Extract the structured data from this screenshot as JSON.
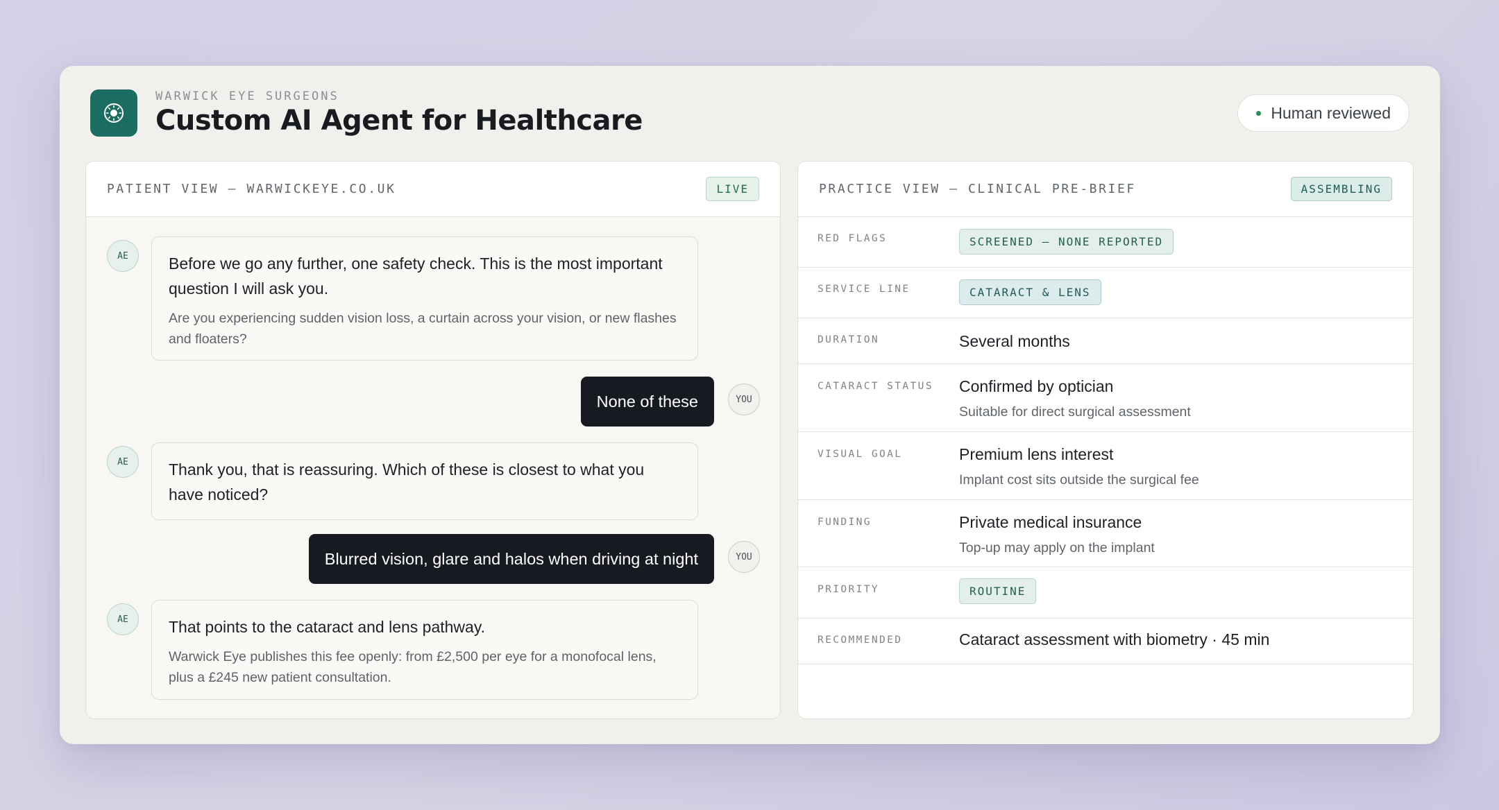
{
  "header": {
    "eyebrow": "WARWICK EYE SURGEONS",
    "title": "Custom AI Agent for Healthcare",
    "logo_icon": "eye-aperture-icon",
    "status_label": "Human reviewed",
    "status_color": "#2e8b5a",
    "accent_color": "#1c6d61"
  },
  "patient_view": {
    "title": "PATIENT VIEW — WARWICKEYE.CO.UK",
    "badge": "LIVE",
    "messages": [
      {
        "sender": "AE",
        "text": "Before we go any further, one safety check. This is the most important question I will ask you.",
        "subtext": "Are you experiencing sudden vision loss, a curtain across your vision, or new flashes and floaters?"
      },
      {
        "sender": "YOU",
        "text": "None of these"
      },
      {
        "sender": "AE",
        "text": "Thank you, that is reassuring. Which of these is closest to what you have noticed?"
      },
      {
        "sender": "YOU",
        "text": "Blurred vision, glare and halos when driving at night"
      },
      {
        "sender": "AE",
        "text": "That points to the cataract and lens pathway.",
        "subtext": "Warwick Eye publishes this fee openly: from £2,500 per eye for a monofocal lens, plus a £245 new patient consultation."
      }
    ]
  },
  "practice_view": {
    "title": "PRACTICE VIEW — CLINICAL PRE-BRIEF",
    "badge": "ASSEMBLING",
    "rows": [
      {
        "label": "RED FLAGS",
        "chip": "SCREENED — NONE REPORTED"
      },
      {
        "label": "SERVICE LINE",
        "chip": "CATARACT & LENS"
      },
      {
        "label": "DURATION",
        "value": "Several months"
      },
      {
        "label": "CATARACT STATUS",
        "value": "Confirmed by optician",
        "subvalue": "Suitable for direct surgical assessment"
      },
      {
        "label": "VISUAL GOAL",
        "value": "Premium lens interest",
        "subvalue": "Implant cost sits outside the surgical fee"
      },
      {
        "label": "FUNDING",
        "value": "Private medical insurance",
        "subvalue": "Top-up may apply on the implant"
      },
      {
        "label": "PRIORITY",
        "chip": "ROUTINE"
      },
      {
        "label": "RECOMMENDED",
        "value": "Cataract assessment with biometry · 45 min"
      }
    ]
  }
}
